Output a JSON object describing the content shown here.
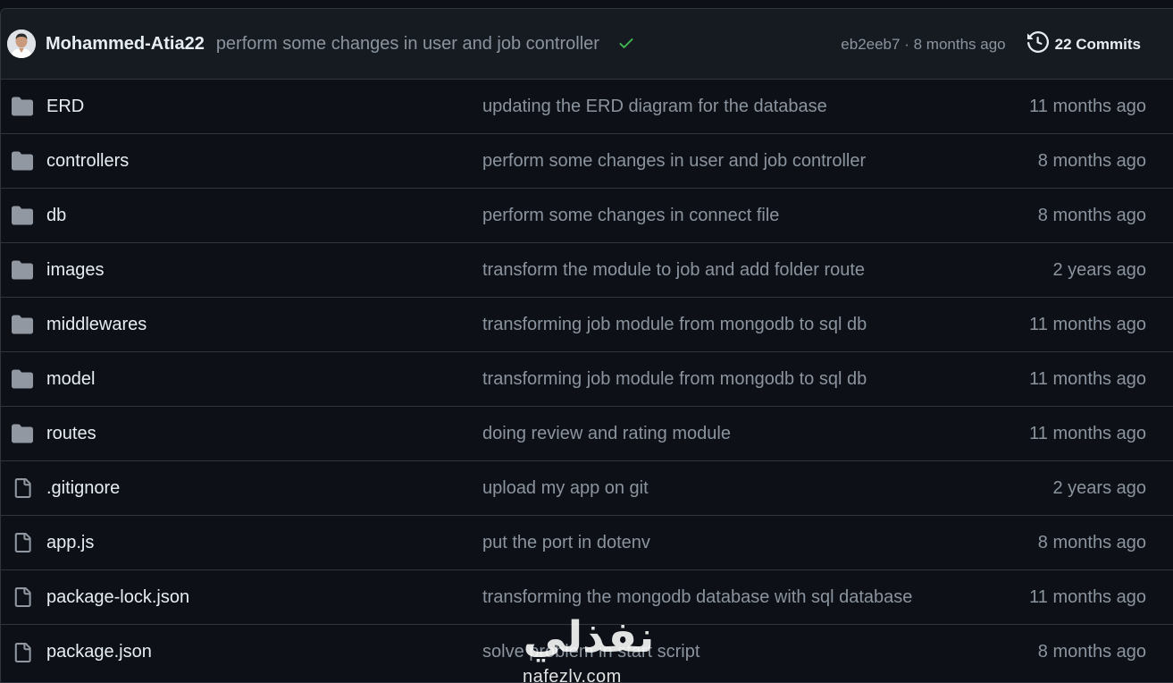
{
  "header": {
    "author": "Mohammed-Atia22",
    "commit_message": "perform some changes in user and job controller",
    "status": "success",
    "sha": "eb2eeb7",
    "separator": "·",
    "commit_time": "8 months ago",
    "commits_label": "22 Commits"
  },
  "colors": {
    "background": "#0d1117",
    "header_background": "#161b22",
    "border": "#30363d",
    "muted_text": "#8b949e",
    "primary_text": "#e6edf3",
    "check_green": "#3fb950",
    "folder_icon": "#9198a1"
  },
  "files": [
    {
      "type": "folder",
      "icon": "folder-icon",
      "name": "ERD",
      "message": "updating the ERD diagram for the database",
      "time": "11 months ago"
    },
    {
      "type": "folder",
      "icon": "folder-icon",
      "name": "controllers",
      "message": "perform some changes in user and job controller",
      "time": "8 months ago"
    },
    {
      "type": "folder",
      "icon": "folder-icon",
      "name": "db",
      "message": "perform some changes in connect file",
      "time": "8 months ago"
    },
    {
      "type": "folder",
      "icon": "folder-icon",
      "name": "images",
      "message": "transform the module to job and add folder route",
      "time": "2 years ago"
    },
    {
      "type": "folder",
      "icon": "folder-icon",
      "name": "middlewares",
      "message": "transforming job module from mongodb to sql db",
      "time": "11 months ago"
    },
    {
      "type": "folder",
      "icon": "folder-icon",
      "name": "model",
      "message": "transforming job module from mongodb to sql db",
      "time": "11 months ago"
    },
    {
      "type": "folder",
      "icon": "folder-icon",
      "name": "routes",
      "message": "doing review and rating module",
      "time": "11 months ago"
    },
    {
      "type": "file",
      "icon": "file-icon",
      "name": ".gitignore",
      "message": "upload my app on git",
      "time": "2 years ago"
    },
    {
      "type": "file",
      "icon": "file-icon",
      "name": "app.js",
      "message": "put the port in dotenv",
      "time": "8 months ago"
    },
    {
      "type": "file",
      "icon": "file-icon",
      "name": "package-lock.json",
      "message": "transforming the mongodb database with sql database",
      "time": "11 months ago"
    },
    {
      "type": "file",
      "icon": "file-icon",
      "name": "package.json",
      "message": "solve problem in start script",
      "time": "8 months ago"
    }
  ],
  "watermark": {
    "arabic": "نفذلي",
    "latin": "nafezly.com"
  }
}
